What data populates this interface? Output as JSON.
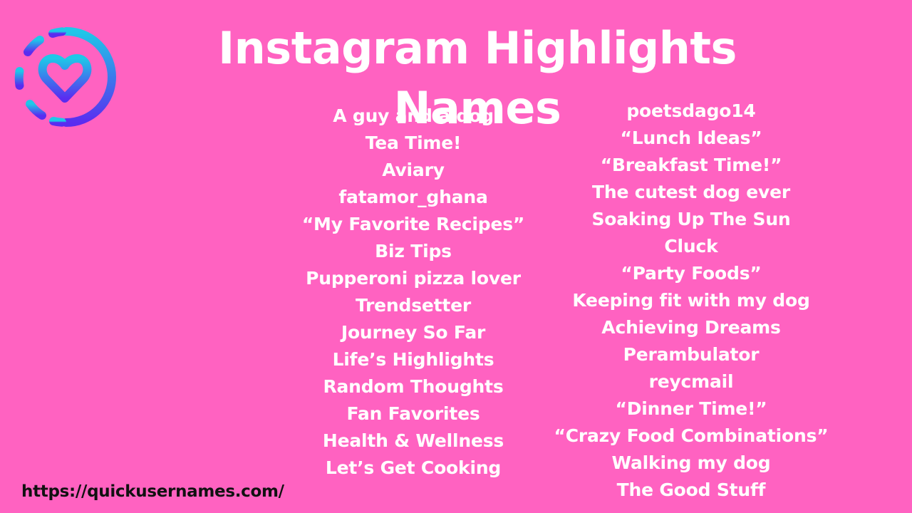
{
  "page": {
    "title": "Instagram Highlights Names",
    "background_color": "#ff62c1",
    "text_color": "#ffffff"
  },
  "logo": {
    "icon": "heart-in-dashed-circle-icon",
    "gradient_start": "#1ec8e8",
    "gradient_end": "#5a2cf0"
  },
  "names": {
    "left": [
      "A guy and a dog",
      "Tea Time!",
      "Aviary",
      "fatamor_ghana",
      "“My Favorite Recipes”",
      "Biz Tips",
      "Pupperoni pizza lover",
      "Trendsetter",
      "Journey So Far",
      "Life’s Highlights",
      "Random Thoughts",
      "Fan Favorites",
      "Health & Wellness",
      "Let’s Get Cooking"
    ],
    "right": [
      "poetsdago14",
      "“Lunch Ideas”",
      "“Breakfast Time!”",
      "The cutest dog ever",
      "Soaking Up The Sun",
      "Cluck",
      "“Party Foods”",
      "Keeping fit with my dog",
      "Achieving Dreams",
      "Perambulator",
      "reycmail",
      "“Dinner Time!”",
      "“Crazy Food Combinations”",
      "Walking my dog",
      "The Good Stuff"
    ]
  },
  "footer": {
    "url": "https://quickusernames.com/"
  }
}
